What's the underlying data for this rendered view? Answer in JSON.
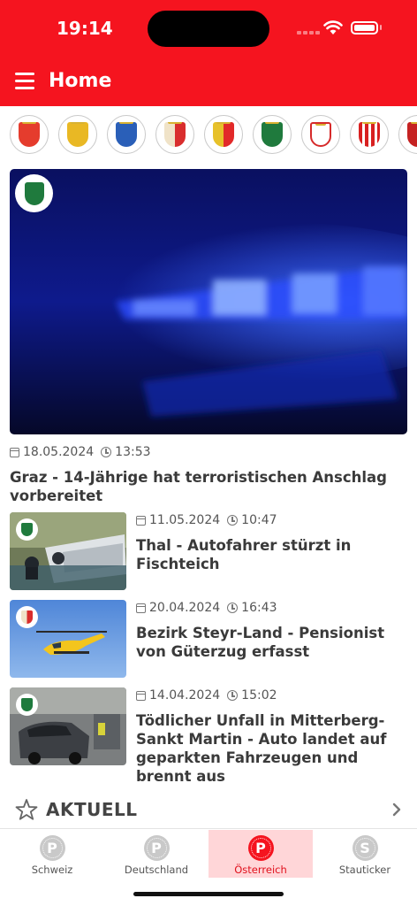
{
  "status_bar": {
    "time": "19:14"
  },
  "app_bar": {
    "title": "Home",
    "menu_icon": "hamburger-menu-icon"
  },
  "colors": {
    "brand_red": "#f5141f",
    "tab_active_bg": "#ffd6d8",
    "inactive_icon": "#c9c9c9"
  },
  "crests": [
    {
      "name": "burgenland-crest-icon",
      "color": "#e53c2d"
    },
    {
      "name": "kaernten-crest-icon",
      "color": "#e9b824"
    },
    {
      "name": "niederoesterreich-crest-icon",
      "color": "#2a5fb8"
    },
    {
      "name": "oberoesterreich-crest-icon",
      "color": "#d92d2d"
    },
    {
      "name": "salzburg-crest-icon",
      "color": "#e22929"
    },
    {
      "name": "steiermark-crest-icon",
      "color": "#1f7a3d"
    },
    {
      "name": "tirol-crest-icon",
      "color": "#d62a2a"
    },
    {
      "name": "vorarlberg-crest-icon",
      "color": "#d82020"
    },
    {
      "name": "wien-crest-icon",
      "color": "#c52222"
    }
  ],
  "hero": {
    "badge_icon": "steiermark-crest-icon",
    "date": "18.05.2024",
    "time": "13:53",
    "headline": "Graz - 14-Jährige hat terroristischen Anschlag vorbereitet"
  },
  "articles": [
    {
      "date": "11.05.2024",
      "time": "10:47",
      "headline": "Thal - Autofahrer stürzt in Fischteich",
      "badge_icon": "steiermark-crest-icon"
    },
    {
      "date": "20.04.2024",
      "time": "16:43",
      "headline": "Bezirk Steyr-Land - Pensionist von Güterzug erfasst",
      "badge_icon": "oberoesterreich-crest-icon"
    },
    {
      "date": "14.04.2024",
      "time": "15:02",
      "headline": "Tödlicher Unfall in Mitterberg-Sankt Martin - Auto landet auf geparkten Fahrzeugen und brennt aus",
      "badge_icon": "steiermark-crest-icon"
    }
  ],
  "section": {
    "title": "AKTUELL",
    "icon": "star-outline-icon"
  },
  "tabs": [
    {
      "label": "Schweiz",
      "letter": "P",
      "active": false
    },
    {
      "label": "Deutschland",
      "letter": "P",
      "active": false
    },
    {
      "label": "Österreich",
      "letter": "P",
      "active": true
    },
    {
      "label": "Stauticker",
      "letter": "S",
      "active": false
    }
  ]
}
